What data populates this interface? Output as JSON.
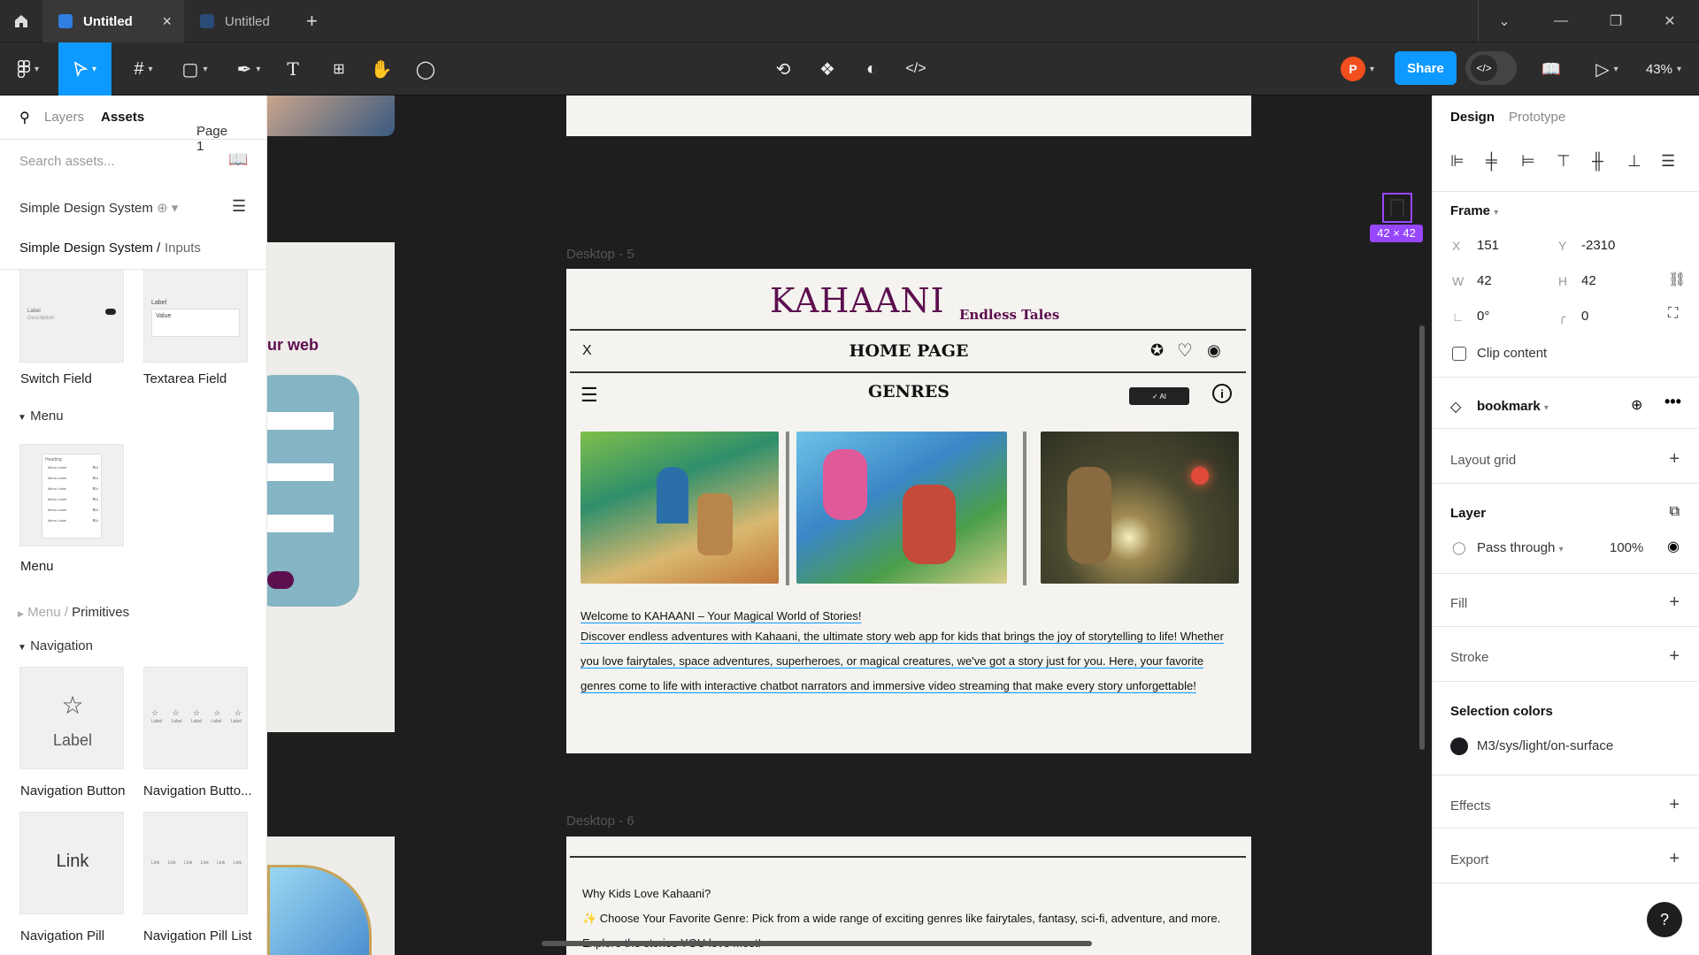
{
  "tabs": [
    {
      "label": "Untitled",
      "active": true,
      "close": "×"
    },
    {
      "label": "Untitled",
      "active": false
    }
  ],
  "new_tab": "+",
  "toolbar": {
    "avatar_initial": "P",
    "share_label": "Share",
    "zoom": "43%"
  },
  "left_panel": {
    "tab_layers": "Layers",
    "tab_assets": "Assets",
    "page": "Page 1",
    "search_placeholder": "Search assets...",
    "library": "Simple Design System",
    "breadcrumb_root": "Simple Design System /",
    "breadcrumb_leaf": "Inputs",
    "components_top": [
      {
        "label": "Switch Field"
      },
      {
        "label": "Textarea Field"
      }
    ],
    "switch_thumb_label": "Label",
    "switch_thumb_desc": "Description",
    "textarea_thumb_label": "Label",
    "textarea_thumb_value": "Value",
    "section_menu": "Menu",
    "menu_component": "Menu",
    "menu_thumb_heading": "Heading",
    "menu_thumb_item": "Menu Label",
    "menu_thumb_shortcut": "⌘A",
    "section_menu_primitives_root": "Menu /",
    "section_menu_primitives_leaf": "Primitives",
    "section_navigation": "Navigation",
    "nav_button_thumb": "Label",
    "nav_bar_thumb_item": "Label",
    "nav_pill_thumb": "Link",
    "nav_pill_list_thumb_item": "Link",
    "components_nav": [
      {
        "label": "Navigation Button"
      },
      {
        "label": "Navigation Butto..."
      },
      {
        "label": "Navigation Pill"
      },
      {
        "label": "Navigation Pill List"
      }
    ]
  },
  "canvas": {
    "left_frame_text": "ur web",
    "frame5_label": "Desktop - 5",
    "frame6_label": "Desktop - 6",
    "badge": "42 × 42",
    "site": {
      "logo": "KAHAANI",
      "tagline": "Endless Tales",
      "close": "X",
      "home": "HOME PAGE",
      "genres": "GENRES",
      "ai_button": "✓ AI",
      "welcome": "Welcome to KAHAANI – Your Magical World of Stories!",
      "line1": "Discover endless adventures with Kahaani, the ultimate story web app for kids that brings the joy of storytelling to life! Whether",
      "line2": "you love fairytales, space adventures, superheroes, or magical creatures, we've got a story just for you. Here, your favorite",
      "line3": "genres come to life with interactive chatbot narrators and immersive video streaming that make every story unforgettable!",
      "why": "Why Kids Love Kahaani?",
      "choose": "✨ Choose Your Favorite Genre: Pick from a wide range of exciting genres like fairytales, fantasy, sci-fi, adventure, and more.",
      "explore": "Explore the stories YOU love most!"
    }
  },
  "right_panel": {
    "tab_design": "Design",
    "tab_prototype": "Prototype",
    "frame_label": "Frame",
    "x_label": "X",
    "x_value": "151",
    "y_label": "Y",
    "y_value": "-2310",
    "w_label": "W",
    "w_value": "42",
    "h_label": "H",
    "h_value": "42",
    "rotation": "0°",
    "radius": "0",
    "clip_content": "Clip content",
    "component_name": "bookmark",
    "layout_grid": "Layout grid",
    "layer": "Layer",
    "blend_mode": "Pass through",
    "opacity": "100%",
    "fill": "Fill",
    "stroke": "Stroke",
    "selection_colors": "Selection colors",
    "selection_color_name": "M3/sys/light/on-surface",
    "effects": "Effects",
    "export": "Export",
    "help": "?"
  },
  "colors": {
    "accent": "#0d99ff",
    "logo": "#5c0f4e",
    "frame_bg": "#f5f3ef",
    "selection": "#9747ff"
  }
}
